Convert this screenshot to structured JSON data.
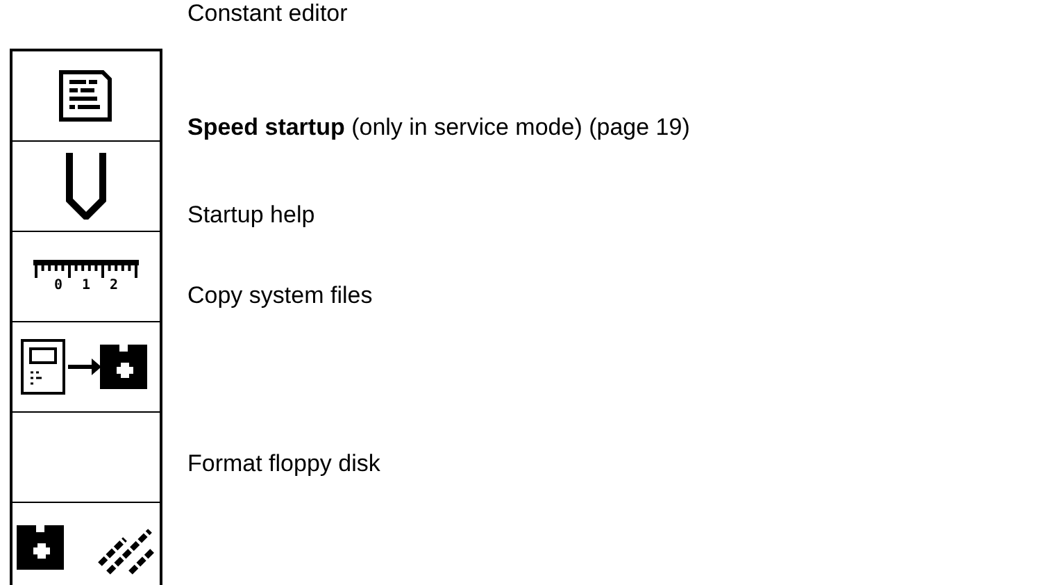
{
  "softkeys": [
    {
      "kind": "document"
    },
    {
      "kind": "tool"
    },
    {
      "kind": "ruler",
      "labels": [
        "0",
        "1",
        "2"
      ]
    },
    {
      "kind": "copy"
    },
    {
      "kind": "empty"
    },
    {
      "kind": "format"
    }
  ],
  "descriptions": [
    "Constant editor",
    "**Speed startup** (only in service mode) (page 19)",
    "Startup help",
    "Copy system files",
    "Format floppy disk"
  ]
}
